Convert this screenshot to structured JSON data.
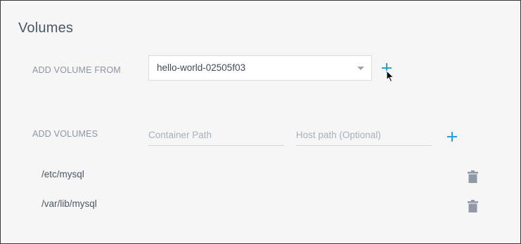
{
  "section": {
    "title": "Volumes"
  },
  "add_volume_from": {
    "label": "ADD VOLUME FROM",
    "selected": "hello-world-02505f03"
  },
  "add_volumes": {
    "label": "ADD VOLUMES",
    "container_path_placeholder": "Container Path",
    "host_path_placeholder": "Host path (Optional)"
  },
  "volumes": [
    {
      "path": "/etc/mysql"
    },
    {
      "path": "/var/lib/mysql"
    }
  ],
  "colors": {
    "accent": "#1fa3e0",
    "background": "#f6f6f6",
    "label": "#8a96a3",
    "trash_icon": "#8f9aa5"
  }
}
